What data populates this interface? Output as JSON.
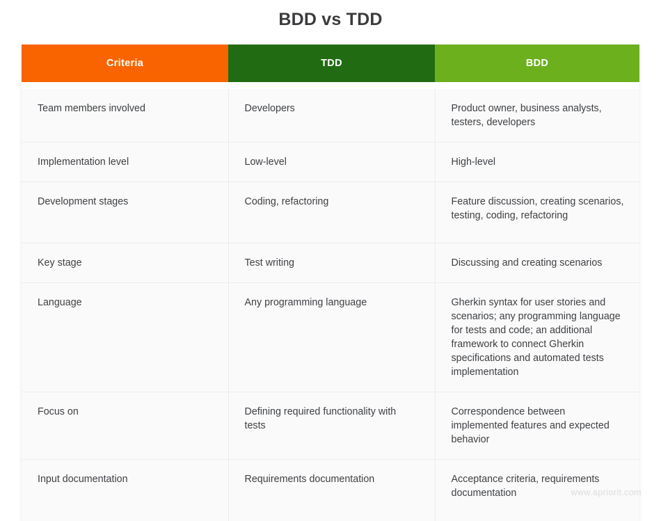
{
  "page": {
    "title": "BDD vs TDD",
    "watermark": "www.apriorit.com",
    "colors": {
      "criteria_header_bg": "#fa6400",
      "tdd_header_bg": "#216c13",
      "bdd_header_bg": "#6cb01e",
      "header_text": "#ffffff",
      "cell_bg": "#fafafa",
      "body_text": "#3e4044",
      "title_text": "#3b3b3d",
      "border": "#ececec",
      "watermark_text": "#dcdcdc"
    }
  },
  "table": {
    "headers": [
      {
        "label": "Criteria"
      },
      {
        "label": "TDD"
      },
      {
        "label": "BDD"
      }
    ],
    "rows": [
      {
        "criteria": "Team members involved",
        "tdd": "Developers",
        "bdd": "Product owner, business analysts, testers, developers"
      },
      {
        "criteria": "Implementation level",
        "tdd": "Low-level",
        "bdd": "High-level"
      },
      {
        "criteria": "Development stages",
        "tdd": "Coding, refactoring",
        "bdd": "Feature discussion, creating scenarios, testing, coding, refactoring"
      },
      {
        "criteria": "Key stage",
        "tdd": "Test writing",
        "bdd": "Discussing and creating scenarios"
      },
      {
        "criteria": "Language",
        "tdd": "Any programming language",
        "bdd": "Gherkin syntax for user stories and scenarios; any programming language for tests and code; an additional framework to connect Gherkin specifications and automated tests implementation"
      },
      {
        "criteria": "Focus on",
        "tdd": "Defining required functionality with tests",
        "bdd": "Correspondence between implemented features and expected behavior"
      },
      {
        "criteria": "Input documentation",
        "tdd": "Requirements documentation",
        "bdd": "Acceptance criteria, requirements documentation"
      }
    ]
  }
}
